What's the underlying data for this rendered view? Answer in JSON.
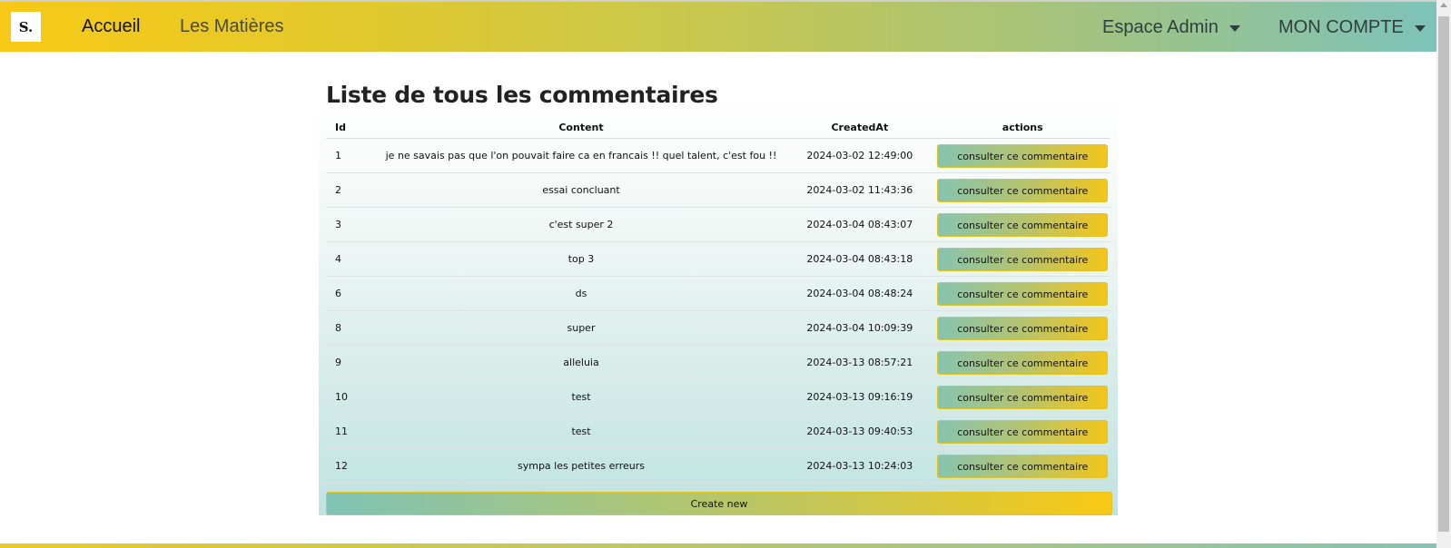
{
  "navbar": {
    "logo_text": "S.",
    "home_label": "Accueil",
    "matieres_label": "Les Matières",
    "admin_label": "Espace Admin",
    "account_label": "MON COMPTE"
  },
  "page": {
    "title": "Liste de tous les commentaires",
    "create_label": "Create new"
  },
  "table": {
    "headers": [
      "Id",
      "Content",
      "CreatedAt",
      "actions"
    ],
    "action_label": "consulter ce commentaire",
    "rows": [
      {
        "id": "1",
        "content": "je ne savais pas que l'on pouvait faire ca en francais !! quel talent, c'est fou !!",
        "created": "2024-03-02 12:49:00"
      },
      {
        "id": "2",
        "content": "essai concluant",
        "created": "2024-03-02 11:43:36"
      },
      {
        "id": "3",
        "content": "c'est super 2",
        "created": "2024-03-04 08:43:07"
      },
      {
        "id": "4",
        "content": "top 3",
        "created": "2024-03-04 08:43:18"
      },
      {
        "id": "6",
        "content": "ds",
        "created": "2024-03-04 08:48:24"
      },
      {
        "id": "8",
        "content": "super",
        "created": "2024-03-04 10:09:39"
      },
      {
        "id": "9",
        "content": "alleluia",
        "created": "2024-03-13 08:57:21"
      },
      {
        "id": "10",
        "content": "test",
        "created": "2024-03-13 09:16:19"
      },
      {
        "id": "11",
        "content": "test",
        "created": "2024-03-13 09:40:53"
      },
      {
        "id": "12",
        "content": "sympa les petites erreurs",
        "created": "2024-03-13 10:24:03"
      }
    ]
  },
  "colors": {
    "brand_yellow": "#f8c916",
    "brand_teal": "#7dc3b9"
  }
}
